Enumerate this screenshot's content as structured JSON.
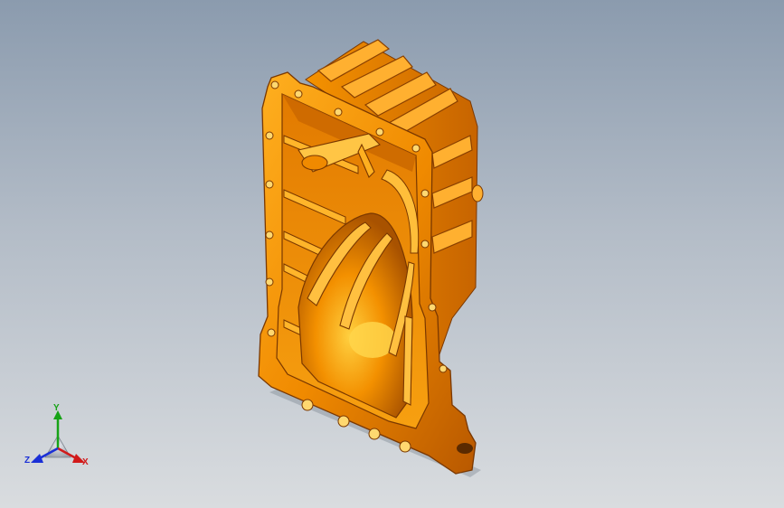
{
  "viewport": {
    "background_top": "#8b9bae",
    "background_bottom": "#d9dcdf"
  },
  "model": {
    "name": "oil-pan",
    "color": "#f08a00",
    "highlight": "#ffc020",
    "shadow": "#8a3f00"
  },
  "triad": {
    "x_label": "X",
    "y_label": "Y",
    "z_label": "Z",
    "x_color": "#d11a1a",
    "y_color": "#16a316",
    "z_color": "#1a2fd6"
  }
}
